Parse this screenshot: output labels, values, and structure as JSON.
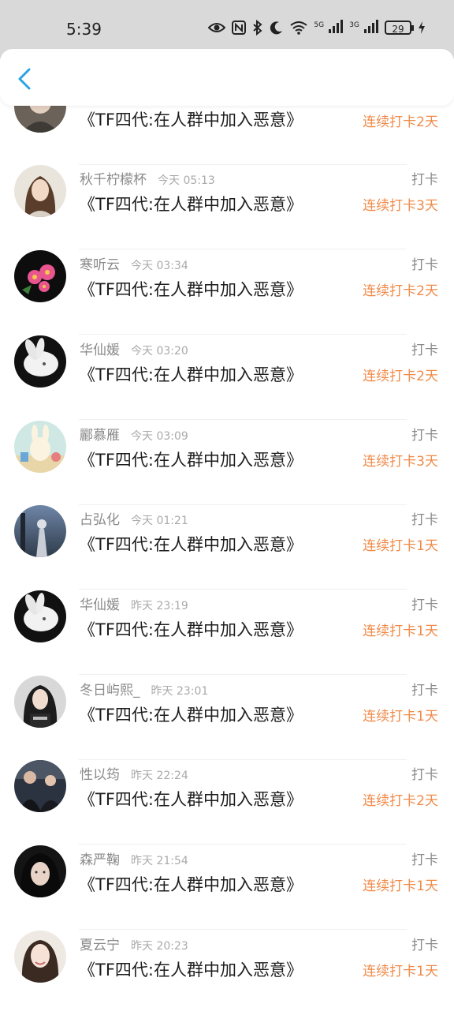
{
  "status_bar": {
    "time": "5:39",
    "signal1_label": "5G",
    "signal2_label": "3G",
    "battery": "29"
  },
  "colors": {
    "accent": "#2aa3e6",
    "streak": "#f08a48"
  },
  "book_title": "《TF四代:在人群中加入恶意》",
  "checkin_label": "打卡",
  "entries": [
    {
      "name": "",
      "time": "",
      "streak": "连续打卡2天",
      "avatar": "partial-girl"
    },
    {
      "name": "秋千柠檬杯",
      "time": "今天 05:13",
      "streak": "连续打卡3天",
      "avatar": "girl-portrait"
    },
    {
      "name": "寒听云",
      "time": "今天 03:34",
      "streak": "连续打卡2天",
      "avatar": "pink-flowers"
    },
    {
      "name": "华仙媛",
      "time": "今天 03:20",
      "streak": "连续打卡2天",
      "avatar": "white-rabbit"
    },
    {
      "name": "酈慕雁",
      "time": "今天 03:09",
      "streak": "连续打卡3天",
      "avatar": "cartoon-rabbit"
    },
    {
      "name": "占弘化",
      "time": "今天 01:21",
      "streak": "连续打卡1天",
      "avatar": "dusk-figure"
    },
    {
      "name": "华仙媛",
      "time": "昨天 23:19",
      "streak": "连续打卡1天",
      "avatar": "white-rabbit"
    },
    {
      "name": "冬日屿熙_",
      "time": "昨天 23:01",
      "streak": "连续打卡1天",
      "avatar": "girl-dark-hair"
    },
    {
      "name": "性以筠",
      "time": "昨天 22:24",
      "streak": "连续打卡2天",
      "avatar": "dark-group"
    },
    {
      "name": "森严鞠",
      "time": "昨天 21:54",
      "streak": "连续打卡1天",
      "avatar": "girl-dark-face"
    },
    {
      "name": "夏云宁",
      "time": "昨天 20:23",
      "streak": "连续打卡1天",
      "avatar": "girl-smiling"
    }
  ]
}
